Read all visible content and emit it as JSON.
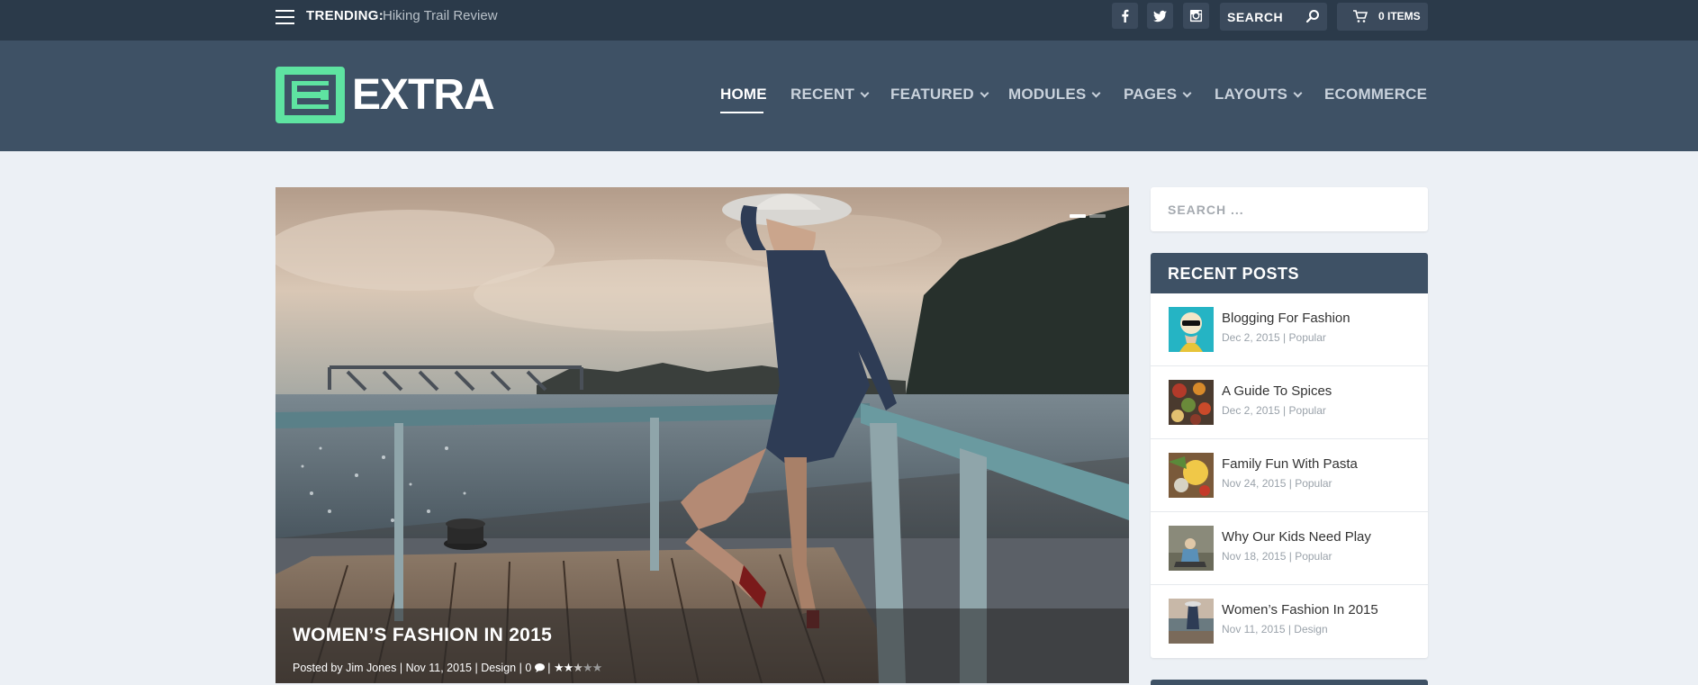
{
  "topbar": {
    "trending_label": "TRENDING:",
    "trending_title": "Hiking Trail Review",
    "social": [
      {
        "icon": "facebook-icon"
      },
      {
        "icon": "twitter-icon"
      },
      {
        "icon": "instagram-icon"
      }
    ],
    "search_placeholder": "SEARCH",
    "cart_label": "0 ITEMS"
  },
  "header": {
    "logo_text": "EXTRA",
    "logo_color": "#5ee3a1",
    "nav": [
      {
        "label": "HOME",
        "active": true,
        "dropdown": false
      },
      {
        "label": "RECENT",
        "dropdown": true
      },
      {
        "label": "FEATURED",
        "dropdown": true
      },
      {
        "label": "MODULES",
        "dropdown": true
      },
      {
        "label": "PAGES",
        "dropdown": true
      },
      {
        "label": "LAYOUTS",
        "dropdown": true
      },
      {
        "label": "ECOMMERCE",
        "dropdown": false
      }
    ]
  },
  "hero": {
    "title": "WOMEN’S FASHION IN 2015",
    "meta": {
      "posted_by": "Posted by",
      "author": "Jim Jones",
      "date": "Nov 11, 2015",
      "category": "Design",
      "comments": "0",
      "rating": 2.5,
      "rating_max": 5
    }
  },
  "sidebar": {
    "search_placeholder": "SEARCH ...",
    "recent_posts": {
      "heading": "RECENT POSTS",
      "items": [
        {
          "title": "Blogging For Fashion",
          "date": "Dec 2, 2015",
          "category": "Popular"
        },
        {
          "title": "A Guide To Spices",
          "date": "Dec 2, 2015",
          "category": "Popular"
        },
        {
          "title": "Family Fun With Pasta",
          "date": "Nov 24, 2015",
          "category": "Popular"
        },
        {
          "title": "Why Our Kids Need Play",
          "date": "Nov 18, 2015",
          "category": "Popular"
        },
        {
          "title": "Women’s Fashion In 2015",
          "date": "Nov 11, 2015",
          "category": "Design"
        }
      ]
    }
  },
  "colors": {
    "topbar": "#2b3a4a",
    "header": "#3e5165",
    "page_bg": "#ecf0f5",
    "accent": "#5ee3a1"
  }
}
